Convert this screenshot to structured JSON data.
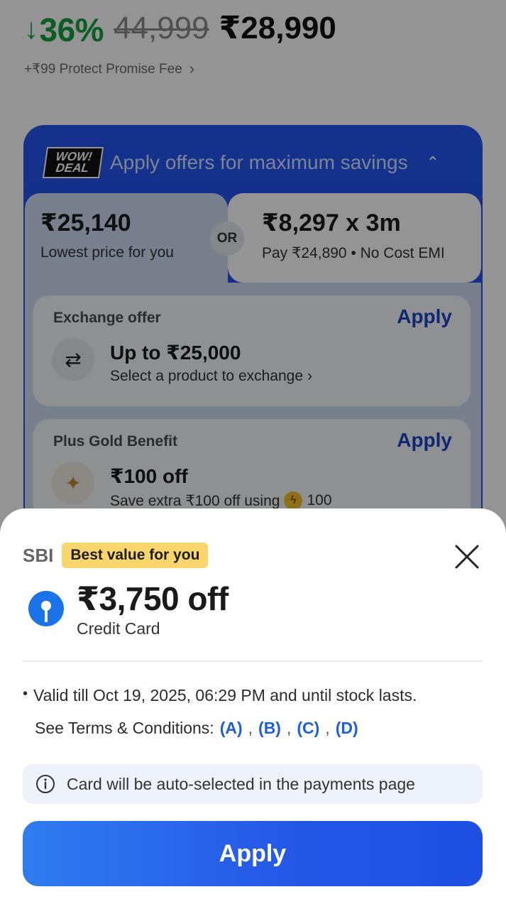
{
  "product": {
    "discount": "36%",
    "mrp": "44,999",
    "price": "₹28,990",
    "protect_fee": "+₹99 Protect Promise Fee"
  },
  "offers": {
    "badge_line1": "WOW!",
    "badge_line2": "DEAL",
    "title": "Apply offers for maximum savings",
    "lowest_price": "₹25,140",
    "lowest_price_label": "Lowest price for you",
    "or_label": "OR",
    "emi_amount": "₹8,297 x 3m",
    "emi_label": "Pay ₹24,890 • No Cost EMI",
    "exchange": {
      "title": "Exchange offer",
      "apply": "Apply",
      "amount": "Up to ₹25,000",
      "sub": "Select a product to exchange"
    },
    "gold": {
      "title": "Plus Gold Benefit",
      "apply": "Apply",
      "amount": "₹100 off",
      "sub": "Save extra ₹100 off using",
      "coins": "100"
    }
  },
  "sheet": {
    "bank": "SBI",
    "badge": "Best value for you",
    "amount": "₹3,750 off",
    "card_type": "Credit Card",
    "validity": "Valid till Oct 19, 2025, 06:29 PM and until stock lasts.",
    "terms_label": "See Terms & Conditions:",
    "terms_links": [
      "(A)",
      "(B)",
      "(C)",
      "(D)"
    ],
    "note": "Card will be auto-selected in the payments page",
    "apply": "Apply"
  },
  "colors": {
    "discount_green": "#14a03c",
    "offers_blue": "#2455f0",
    "link_blue": "#1d5fd8",
    "badge_yellow": "#f8d66b",
    "apply_gradient_start": "#2f7cf0",
    "apply_gradient_end": "#1d4fe3"
  }
}
